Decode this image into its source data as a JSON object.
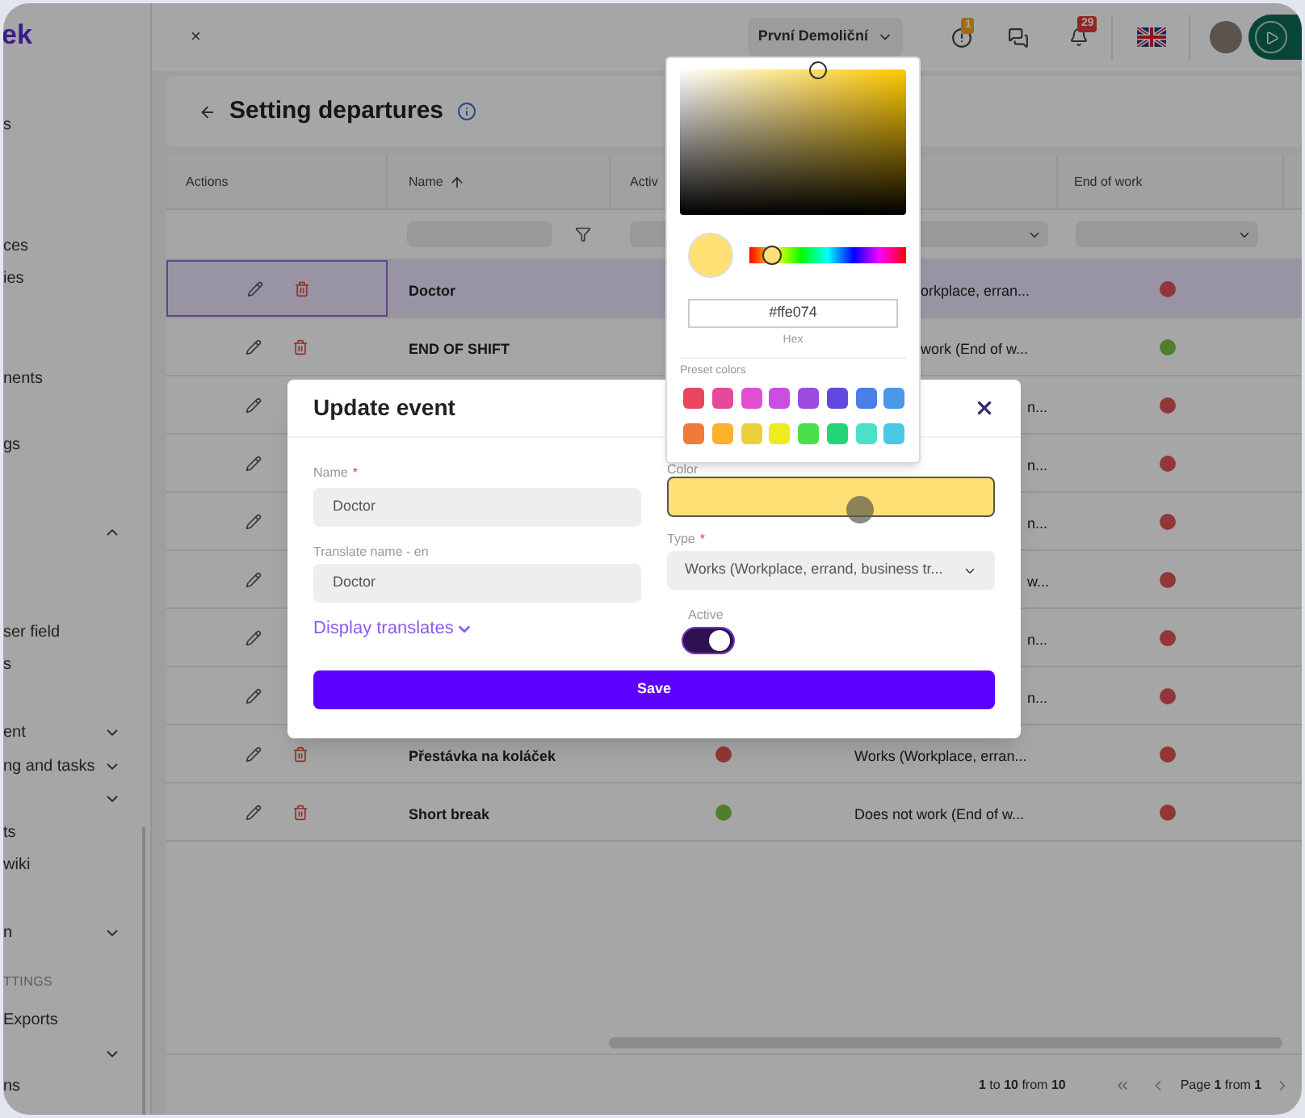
{
  "sidebar": {
    "logo": "ek",
    "items": [
      {
        "label": "s",
        "kind": "item"
      },
      {
        "label": "ces",
        "kind": "item"
      },
      {
        "label": "ies",
        "kind": "item"
      },
      {
        "label": "nents",
        "kind": "item"
      },
      {
        "label": "gs",
        "kind": "item"
      },
      {
        "kind": "group",
        "expanded": true
      },
      {
        "label": "ser field",
        "kind": "item"
      },
      {
        "label": "s",
        "kind": "item"
      },
      {
        "label": "ent",
        "kind": "group",
        "expanded": false
      },
      {
        "label": "ng and tasks",
        "kind": "group",
        "expanded": false
      },
      {
        "kind": "group",
        "expanded": false
      },
      {
        "label": "ts",
        "kind": "item"
      },
      {
        "label": "wiki",
        "kind": "item"
      },
      {
        "label": "n",
        "kind": "group",
        "expanded": false
      },
      {
        "label": "TTINGS",
        "kind": "section"
      },
      {
        "label": "Exports",
        "kind": "item"
      },
      {
        "kind": "group",
        "expanded": false
      },
      {
        "label": "ns",
        "kind": "item"
      }
    ]
  },
  "topbar": {
    "close": "×",
    "company": "První Demoliční",
    "alerts_badge": "1",
    "notifications_badge": "29"
  },
  "page": {
    "title": "Setting departures"
  },
  "table": {
    "header": {
      "actions": "Actions",
      "name": "Name",
      "active": "Activ",
      "end_of_work": "End of work"
    },
    "name_sort_ascending": true,
    "rows": [
      {
        "selected": true,
        "name": "Doctor",
        "type": {
          "text": "orkplace, erran...",
          "kind": "under_popup"
        },
        "end_of_work": false
      },
      {
        "selected": false,
        "name": "END OF SHIFT",
        "type": {
          "text": "work (End of w...",
          "kind": "under_popup"
        },
        "end_of_work": true
      },
      {
        "selected": false,
        "type": {
          "text": "n...",
          "kind": "under_modal"
        },
        "end_of_work": false
      },
      {
        "selected": false,
        "type": {
          "text": "n...",
          "kind": "under_modal"
        },
        "end_of_work": false
      },
      {
        "selected": false,
        "type": {
          "text": "n...",
          "kind": "under_modal"
        },
        "end_of_work": false
      },
      {
        "selected": false,
        "type": {
          "text": "w...",
          "kind": "under_modal"
        },
        "end_of_work": false
      },
      {
        "selected": false,
        "type": {
          "text": "n...",
          "kind": "under_modal"
        },
        "end_of_work": false
      },
      {
        "selected": false,
        "type": {
          "text": "n...",
          "kind": "under_modal"
        },
        "end_of_work": false
      },
      {
        "selected": false,
        "name": "Přestávka na koláček",
        "active": false,
        "type": {
          "text": "Works (Workplace, erran...",
          "kind": "full"
        },
        "end_of_work": false
      },
      {
        "selected": false,
        "name": "Short break",
        "active": true,
        "type": {
          "text": "Does not work (End of w...",
          "kind": "full"
        },
        "end_of_work": false
      }
    ],
    "range": "**1** to **10** from **10**",
    "page": "Page **1** from **1**"
  },
  "modal": {
    "title": "Update event",
    "name_label": "Name",
    "name_required_mark": "*",
    "name_value": "Doctor",
    "translate_label": "Translate name - en",
    "translate_value": "Doctor",
    "display_translates": "Display translates",
    "color_label": "Color",
    "color": "#ffe074",
    "type_label": "Type",
    "type_required_mark": "*",
    "type_value": "Works (Workplace, errand, business tr...",
    "active_label": "Active",
    "active_on": true,
    "save": "Save"
  },
  "picker": {
    "hue": {
      "level": 0.14
    },
    "hex": "#ffe074",
    "hex_label": "Hex",
    "presets_label": "Preset colors",
    "presets": [
      {
        "color": "#e8475f"
      },
      {
        "color": "#e54a9a"
      },
      {
        "color": "#e04fcf"
      },
      {
        "color": "#c84fe0"
      },
      {
        "color": "#9b4be0"
      },
      {
        "color": "#6248e0"
      },
      {
        "color": "#4a7fe6"
      },
      {
        "color": "#4a97e8"
      },
      {
        "color": "#f07a3c"
      },
      {
        "color": "#fbb02e"
      },
      {
        "color": "#ecd03c"
      },
      {
        "color": "#ecec1e"
      },
      {
        "color": "#4ae04a"
      },
      {
        "color": "#22d47a"
      },
      {
        "color": "#4ce0c8"
      },
      {
        "color": "#4ac8e6"
      }
    ]
  }
}
